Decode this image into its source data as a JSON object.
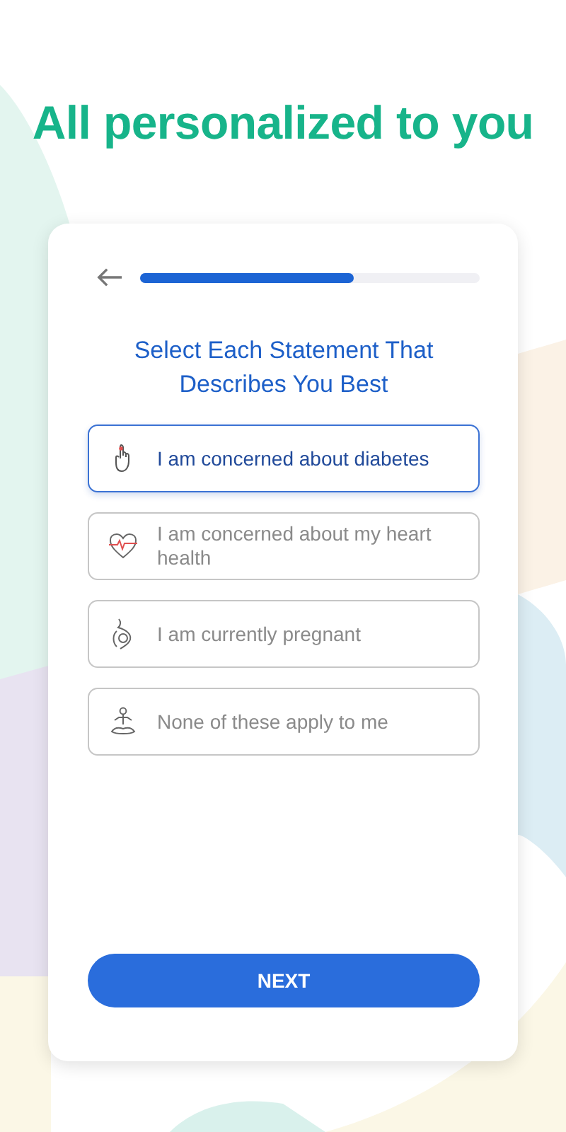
{
  "headline": "All personalized to you",
  "progress": {
    "level": 0.63
  },
  "question": "Select Each Statement That Describes You Best",
  "options": [
    {
      "kind": "finger",
      "label": "I am concerned about diabetes",
      "selected": true
    },
    {
      "kind": "heart",
      "label": "I am concerned about my heart health",
      "selected": false
    },
    {
      "kind": "pregnant",
      "label": "I am currently pregnant",
      "selected": false
    },
    {
      "kind": "meditation",
      "label": "None of these apply to me",
      "selected": false
    }
  ],
  "next_button": "NEXT"
}
